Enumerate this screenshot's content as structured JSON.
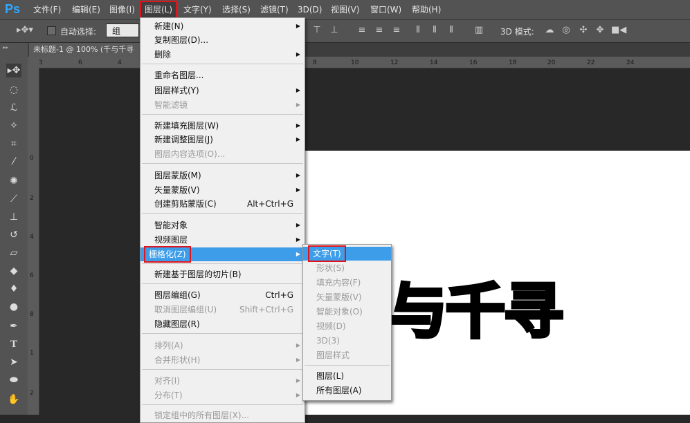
{
  "app": {
    "logo": "Ps"
  },
  "menubar": [
    "文件(F)",
    "编辑(E)",
    "图像(I)",
    "图层(L)",
    "文字(Y)",
    "选择(S)",
    "滤镜(T)",
    "3D(D)",
    "视图(V)",
    "窗口(W)",
    "帮助(H)"
  ],
  "options": {
    "auto_select_label": "自动选择:",
    "group_value": "组",
    "mode_3d_label": "3D 模式:"
  },
  "document": {
    "tab_title": "未标题-1 @ 100% (千与千寻"
  },
  "rulers": {
    "h": [
      "3",
      "6",
      "4",
      "8",
      "10",
      "12",
      "14",
      "16",
      "18",
      "20",
      "22",
      "24"
    ],
    "v": [
      "0",
      "2",
      "4",
      "6",
      "8",
      "1",
      "2"
    ]
  },
  "canvas": {
    "text": "与千寻"
  },
  "layer_menu": {
    "items": [
      {
        "label": "新建(N)",
        "arrow": true
      },
      {
        "label": "复制图层(D)..."
      },
      {
        "label": "删除",
        "arrow": true
      },
      {
        "label": "重命名图层..."
      },
      {
        "label": "图层样式(Y)",
        "arrow": true
      },
      {
        "label": "智能滤镜",
        "arrow": true,
        "disabled": true
      },
      {
        "label": "新建填充图层(W)",
        "arrow": true
      },
      {
        "label": "新建调整图层(J)",
        "arrow": true
      },
      {
        "label": "图层内容选项(O)...",
        "disabled": true
      },
      {
        "label": "图层蒙版(M)",
        "arrow": true
      },
      {
        "label": "矢量蒙版(V)",
        "arrow": true
      },
      {
        "label": "创建剪贴蒙版(C)",
        "shortcut": "Alt+Ctrl+G"
      },
      {
        "label": "智能对象",
        "arrow": true
      },
      {
        "label": "视频图层",
        "arrow": true
      },
      {
        "label": "栅格化(Z)",
        "arrow": true,
        "highlighted": true
      },
      {
        "label": "新建基于图层的切片(B)"
      },
      {
        "label": "图层编组(G)",
        "shortcut": "Ctrl+G"
      },
      {
        "label": "取消图层编组(U)",
        "shortcut": "Shift+Ctrl+G",
        "disabled": true
      },
      {
        "label": "隐藏图层(R)"
      },
      {
        "label": "排列(A)",
        "arrow": true,
        "disabled": true
      },
      {
        "label": "合并形状(H)",
        "arrow": true,
        "disabled": true
      },
      {
        "label": "对齐(I)",
        "arrow": true,
        "disabled": true
      },
      {
        "label": "分布(T)",
        "arrow": true,
        "disabled": true
      },
      {
        "label": "锁定组中的所有图层(X)...",
        "disabled": true
      }
    ]
  },
  "rasterize_menu": {
    "items": [
      {
        "label": "文字(T)",
        "highlighted": true
      },
      {
        "label": "形状(S)",
        "disabled": true
      },
      {
        "label": "填充内容(F)",
        "disabled": true
      },
      {
        "label": "矢量蒙版(V)",
        "disabled": true
      },
      {
        "label": "智能对象(O)",
        "disabled": true
      },
      {
        "label": "视频(D)",
        "disabled": true
      },
      {
        "label": "3D(3)",
        "disabled": true
      },
      {
        "label": "图层样式",
        "disabled": true
      },
      {
        "label": "图层(L)"
      },
      {
        "label": "所有图层(A)"
      }
    ]
  }
}
